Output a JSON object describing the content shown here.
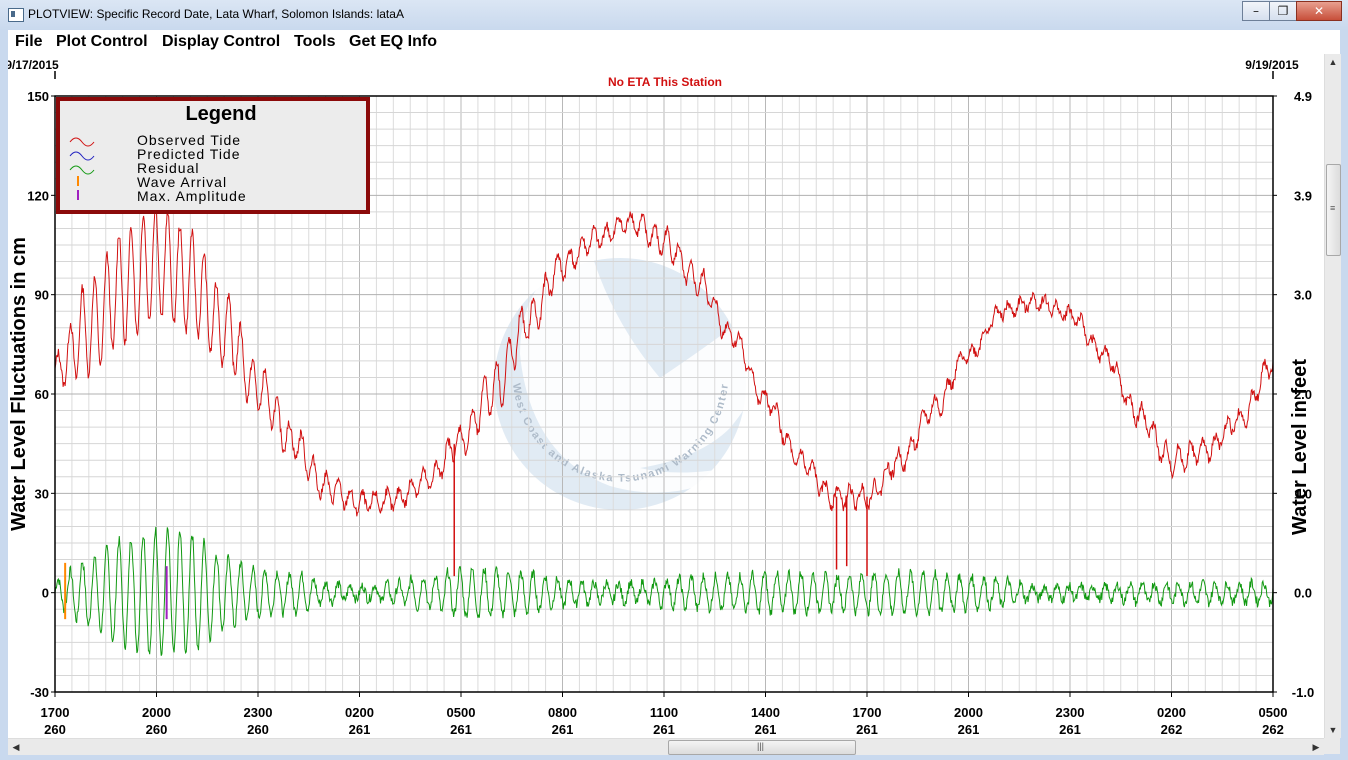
{
  "window": {
    "title": "PLOTVIEW: Specific Record Date, Lata Wharf, Solomon Islands: lataA"
  },
  "menu": {
    "items": [
      "File",
      "Plot Control",
      "Display Control",
      "Tools",
      "Get EQ Info"
    ]
  },
  "plot": {
    "start_date": "9/17/2015",
    "end_date": "9/19/2015",
    "eta_text": "No ETA This Station"
  },
  "legend": {
    "title": "Legend",
    "items": [
      "Observed Tide",
      "Predicted Tide",
      "Residual",
      "Wave Arrival",
      "Max. Amplitude"
    ]
  },
  "colors": {
    "observed": "#d11010",
    "predicted": "#2020c0",
    "residual": "#119911",
    "wave_arrival": "#ff8800",
    "max_amplitude": "#a020c0",
    "eta": "#d11010",
    "legend_border": "#8b0a0a"
  },
  "watermark_text": "West Coast and Alaska Tsunami Warning Center",
  "chart_data": {
    "type": "line",
    "ylabel": "Water Level Fluctuations in cm",
    "y2label": "Water Level in feet",
    "ylim": [
      -30,
      150
    ],
    "y2lim": [
      -1.0,
      4.9
    ],
    "yticks": [
      "150",
      "120",
      "90",
      "60",
      "30",
      "0",
      "-30"
    ],
    "y2ticks": [
      "4.9",
      "3.9",
      "3.0",
      "2.0",
      "1.0",
      "0.0",
      "-1.0"
    ],
    "xticks": [
      {
        "hour": "1700",
        "day": "260"
      },
      {
        "hour": "2000",
        "day": "260"
      },
      {
        "hour": "2300",
        "day": "260"
      },
      {
        "hour": "0200",
        "day": "261"
      },
      {
        "hour": "0500",
        "day": "261"
      },
      {
        "hour": "0800",
        "day": "261"
      },
      {
        "hour": "1100",
        "day": "261"
      },
      {
        "hour": "1400",
        "day": "261"
      },
      {
        "hour": "1700",
        "day": "261"
      },
      {
        "hour": "2000",
        "day": "261"
      },
      {
        "hour": "2300",
        "day": "261"
      },
      {
        "hour": "0200",
        "day": "262"
      },
      {
        "hour": "0500",
        "day": "262"
      }
    ],
    "xlim_hours": [
      0,
      36
    ],
    "grid": true,
    "legend_position": "top-left",
    "series": [
      {
        "name": "Observed Tide",
        "x": [
          0,
          1,
          2,
          3,
          4,
          5,
          6,
          7,
          8,
          9,
          10,
          11,
          12,
          13,
          14,
          15,
          16,
          17,
          18,
          19,
          20,
          21,
          22,
          23,
          24,
          25,
          26,
          27,
          28,
          29,
          30,
          31,
          32,
          33,
          34,
          35,
          36
        ],
        "y": [
          67,
          80,
          92,
          100,
          94,
          80,
          62,
          46,
          32,
          27,
          28,
          34,
          46,
          62,
          82,
          99,
          107,
          112,
          106,
          94,
          78,
          58,
          40,
          29,
          29,
          40,
          56,
          72,
          85,
          88,
          84,
          72,
          54,
          40,
          43,
          52,
          69
        ],
        "oscillation_amplitude": [
          5,
          14,
          17,
          17,
          15,
          11,
          7,
          5,
          4,
          3,
          3,
          3,
          4,
          8,
          6,
          4,
          3,
          3,
          4,
          4,
          3,
          3,
          3,
          3,
          3,
          3,
          3,
          2,
          2,
          2,
          2,
          2,
          3,
          4,
          3,
          3,
          3
        ]
      },
      {
        "name": "Residual",
        "x": [
          0,
          1,
          2,
          3,
          4,
          5,
          6,
          7,
          8,
          9,
          10,
          11,
          12,
          13,
          14,
          15,
          16,
          17,
          18,
          19,
          20,
          21,
          22,
          23,
          24,
          25,
          26,
          27,
          28,
          29,
          30,
          31,
          32,
          33,
          34,
          35,
          36
        ],
        "y": [
          0,
          0,
          0,
          0,
          0,
          0,
          0,
          0,
          0,
          0,
          0,
          0,
          0,
          0,
          0,
          0,
          0,
          0,
          0,
          0,
          0,
          0,
          0,
          0,
          0,
          0,
          0,
          0,
          0,
          0,
          0,
          0,
          0,
          0,
          0,
          0,
          0
        ],
        "oscillation_amplitude": [
          4,
          10,
          16,
          19,
          18,
          11,
          7,
          6,
          3,
          2,
          3,
          5,
          7,
          7,
          6,
          4,
          3,
          3,
          4,
          5,
          5,
          6,
          6,
          5,
          6,
          6,
          6,
          5,
          4,
          2,
          2,
          2,
          3,
          3,
          3,
          3,
          3
        ]
      }
    ],
    "spikes_cm": [
      {
        "x_hour": 11.8,
        "y": 5
      },
      {
        "x_hour": 23.1,
        "y": 7
      },
      {
        "x_hour": 23.4,
        "y": 8
      },
      {
        "x_hour": 24.0,
        "y": 5
      }
    ],
    "wave_arrival_hour": 0.3,
    "max_amplitude_hour": 3.3
  }
}
